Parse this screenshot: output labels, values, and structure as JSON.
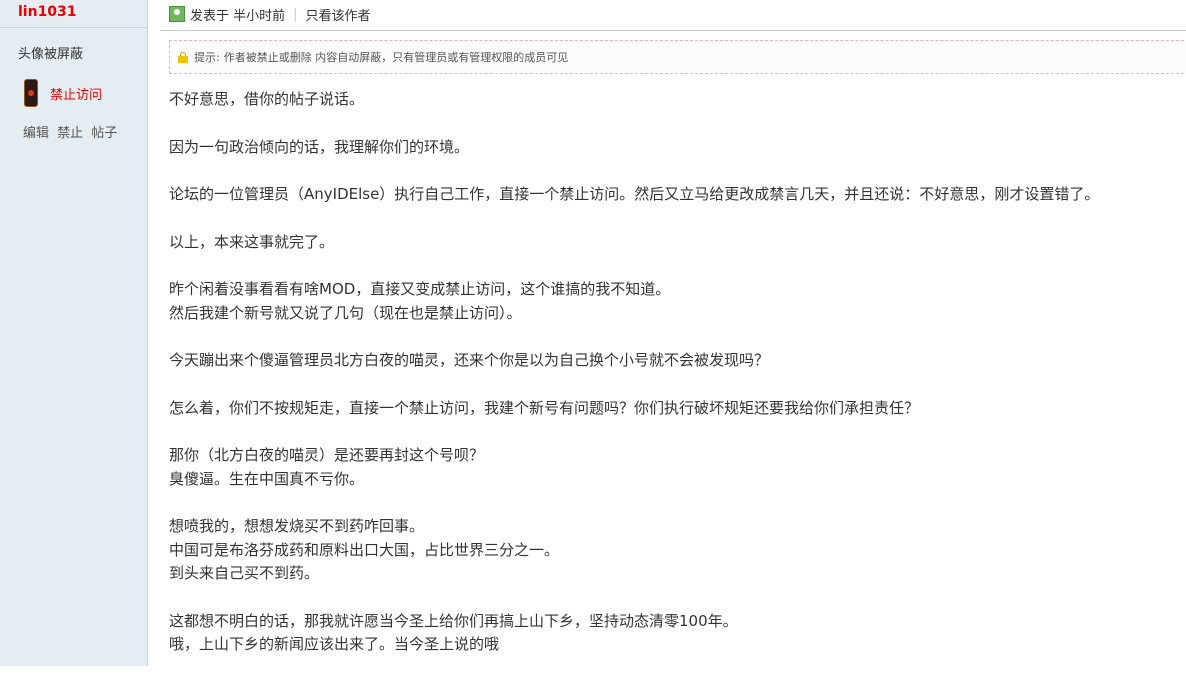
{
  "sidebar": {
    "username": "lin1031",
    "avatar_notice": "头像被屏蔽",
    "ban_status": "禁止访问",
    "admin_links": [
      "编辑",
      "禁止",
      "帖子"
    ]
  },
  "post_meta": {
    "posted": "发表于 半小时前",
    "only_author": "只看该作者"
  },
  "notice": {
    "label": "提示:",
    "text": "作者被禁止或删除 内容自动屏蔽，只有管理员或有管理权限的成员可见"
  },
  "content": {
    "paragraphs": [
      [
        "不好意思，借你的帖子说话。"
      ],
      [
        "因为一句政治倾向的话，我理解你们的环境。"
      ],
      [
        "论坛的一位管理员（AnyIDElse）执行自己工作，直接一个禁止访问。然后又立马给更改成禁言几天，并且还说：不好意思，刚才设置错了。"
      ],
      [
        "以上，本来这事就完了。"
      ],
      [
        "昨个闲着没事看看有啥MOD，直接又变成禁止访问，这个谁搞的我不知道。",
        "然后我建个新号就又说了几句（现在也是禁止访问）。"
      ],
      [
        "今天蹦出来个傻逼管理员北方白夜的喵灵，还来个你是以为自己换个小号就不会被发现吗？"
      ],
      [
        "怎么着，你们不按规矩走，直接一个禁止访问，我建个新号有问题吗？你们执行破坏规矩还要我给你们承担责任？"
      ],
      [
        "那你（北方白夜的喵灵）是还要再封这个号呗？",
        "臭傻逼。生在中国真不亏你。"
      ],
      [
        "想喷我的，想想发烧买不到药咋回事。",
        "中国可是布洛芬成药和原料出口大国，占比世界三分之一。",
        "到头来自己买不到药。"
      ],
      [
        "这都想不明白的话，那我就许愿当今圣上给你们再搞上山下乡，坚持动态清零100年。",
        "哦，上山下乡的新闻应该出来了。当今圣上说的哦"
      ]
    ]
  }
}
